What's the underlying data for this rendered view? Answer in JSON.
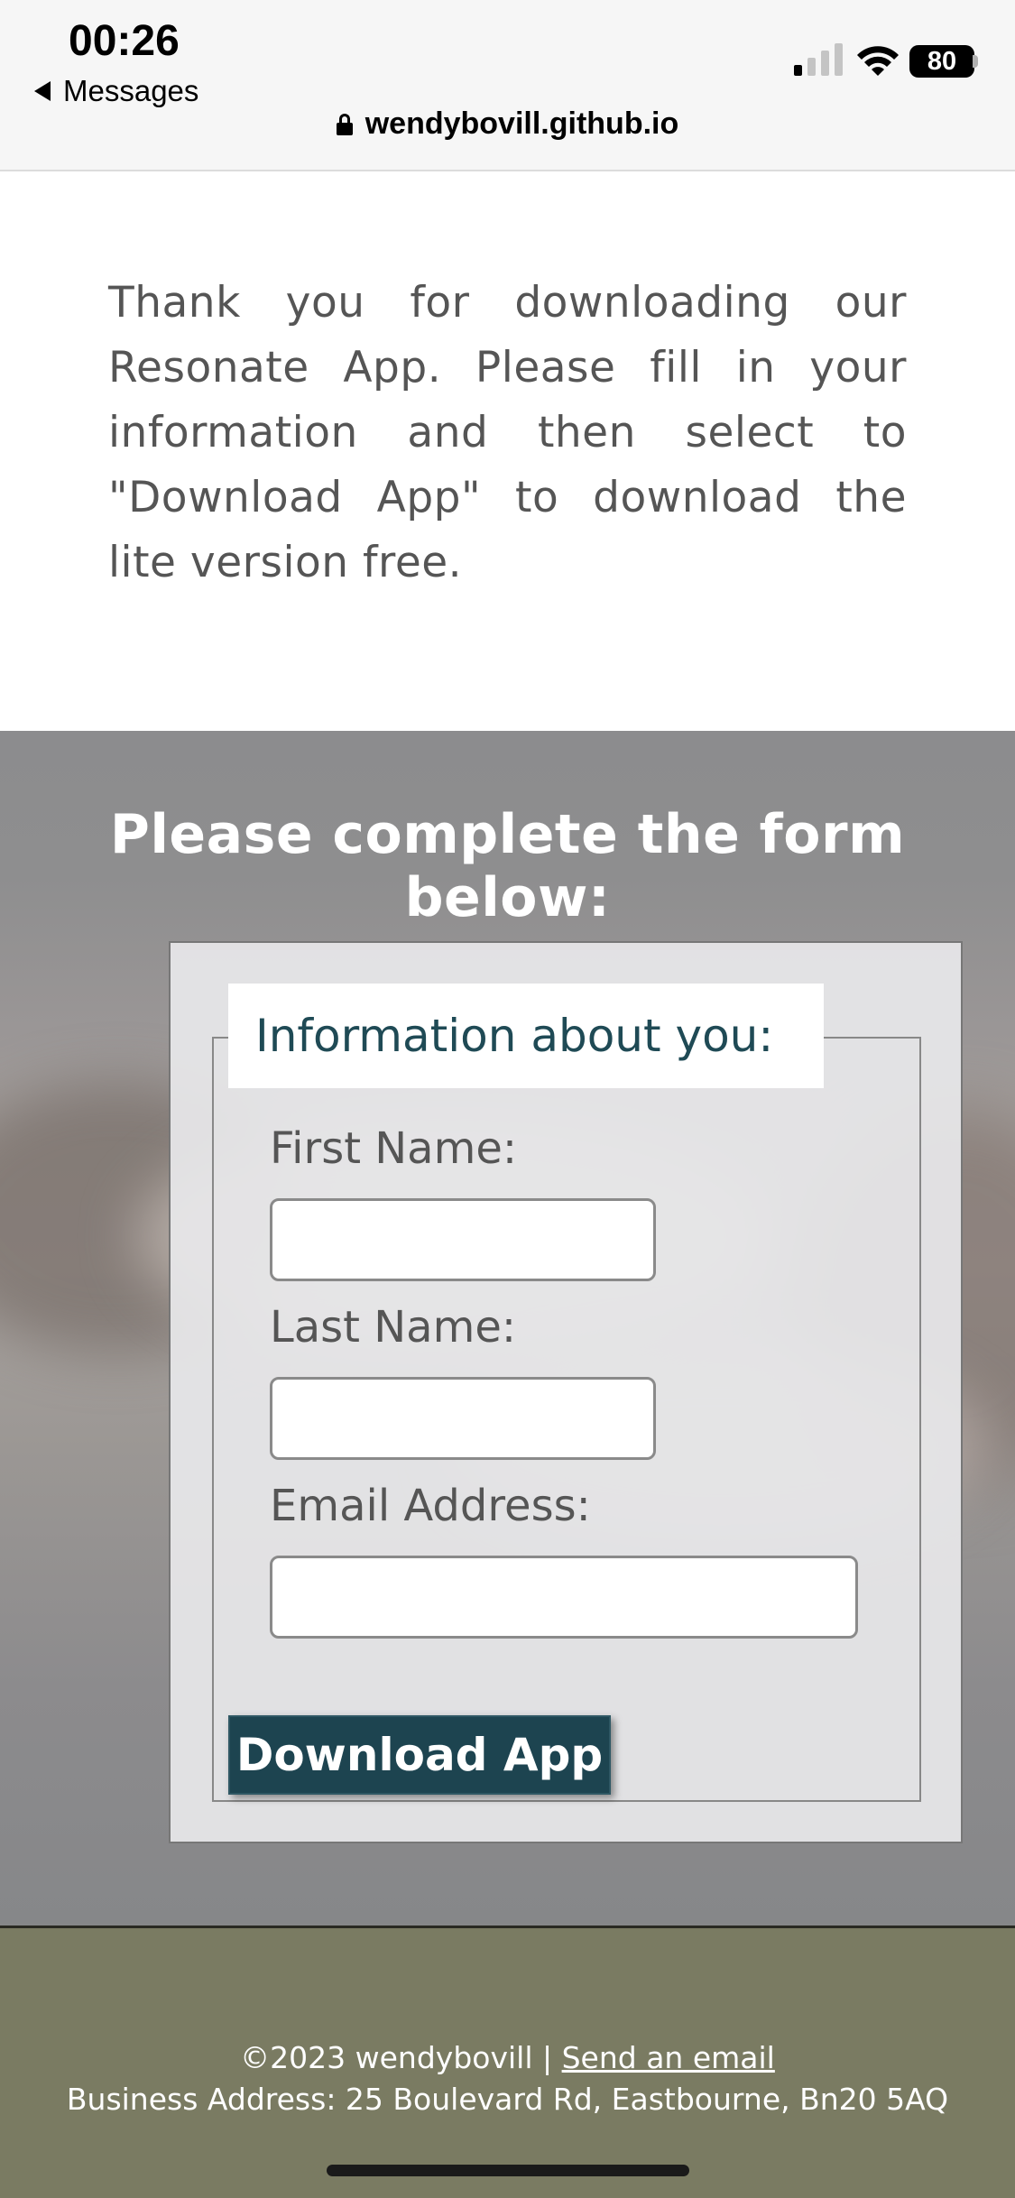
{
  "status_bar": {
    "time": "00:26",
    "back_label": "Messages",
    "battery": "80",
    "url": "wendybovill.github.io",
    "icons": [
      "back-arrow-icon",
      "signal-icon",
      "wifi-icon",
      "battery-icon",
      "lock-icon"
    ]
  },
  "intro": {
    "text": "Thank you for downloading our Resonate App. Please fill in your information and then select to \"Download App\" to download the lite version free."
  },
  "form": {
    "heading": "Please complete the form below:",
    "legend": "Information about you:",
    "first_name_label": "First Name:",
    "first_name_value": "",
    "last_name_label": "Last Name:",
    "last_name_value": "",
    "email_label": "Email Address:",
    "email_value": "",
    "submit_label": "Download App"
  },
  "footer": {
    "copyright": "©2023 wendybovill | ",
    "email_link": "Send an email",
    "address": "Business Address: 25 Boulevard Rd, Eastbourne, Bn20 5AQ"
  },
  "colors": {
    "button_bg": "#1d4450",
    "legend_text": "#1f4a55",
    "footer_bg": "#7a7b62",
    "form_box_bg": "#e8e8ea"
  }
}
